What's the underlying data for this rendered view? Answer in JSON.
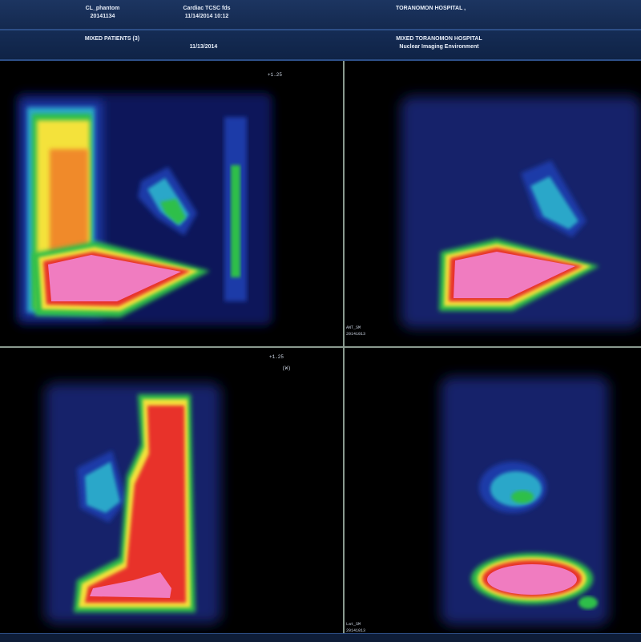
{
  "header": {
    "patient_name": "CL_phantom",
    "patient_id": "20141134",
    "study_name": "Cardiac TCSC fds",
    "study_datetime": "11/14/2014 10:12",
    "hospital": "TORANOMON HOSPITAL ,"
  },
  "subheader": {
    "patients_label": "MIXED PATIENTS (3)",
    "date": "11/13/2014",
    "institution": "MIXED TORANOMON HOSPITAL",
    "department": "Nuclear Imaging Environment"
  },
  "panels": {
    "top_left": {
      "scale_label": "+1.25"
    },
    "top_right": {
      "view_label": "ANT_SM",
      "view_date": "20141013"
    },
    "bottom_left": {
      "scale_label": "+1.25",
      "marker": "(W)"
    },
    "bottom_right": {
      "view_label": "Lat_SM",
      "view_date": "20141013"
    }
  },
  "colors": {
    "header_bg": "#1c3561",
    "divider": "#8a9a8f",
    "hot_pink": "#f07cc0",
    "red": "#e8332a",
    "yellow": "#f4e23a",
    "green": "#2fbf4a",
    "cyan": "#2aa7c9",
    "blue": "#1d3aa8"
  }
}
